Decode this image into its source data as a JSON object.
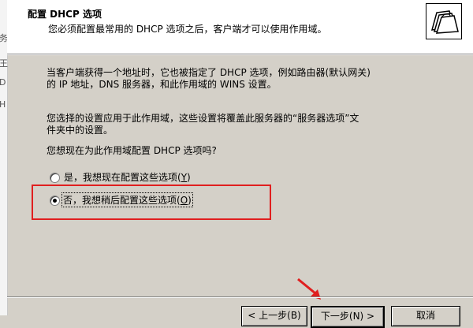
{
  "window": {
    "left_strip_chars": [
      "务",
      "王",
      "D",
      "H"
    ]
  },
  "header": {
    "title": "配置 DHCP 选项",
    "subtitle": "您必须配置最常用的 DHCP 选项之后，客户端才可以使用作用域。",
    "icon": "folders-wizard-icon"
  },
  "body": {
    "para1_line1": "当客户端获得一个地址时，它也被指定了 DHCP 选项，例如路由器(默认网关)",
    "para1_line2": "的 IP 地址，DNS 服务器，和此作用域的 WINS 设置。",
    "para2_line1": "您选择的设置应用于此作用域，这些设置将覆盖此服务器的“服务器选项”文",
    "para2_line2": "件夹中的设置。",
    "question": "您想现在为此作用域配置 DHCP 选项吗?",
    "options": [
      {
        "label": "是，我想现在配置这些选项",
        "hotkey": "Y",
        "selected": false
      },
      {
        "label": "否，我想稍后配置这些选项",
        "hotkey": "O",
        "selected": true
      }
    ]
  },
  "footer": {
    "back_label": "< 上一步(B)",
    "next_label": "下一步(N) >",
    "cancel_label": "取消"
  },
  "colors": {
    "highlight_box": "#e01f1f",
    "arrow": "#e01f1f"
  }
}
